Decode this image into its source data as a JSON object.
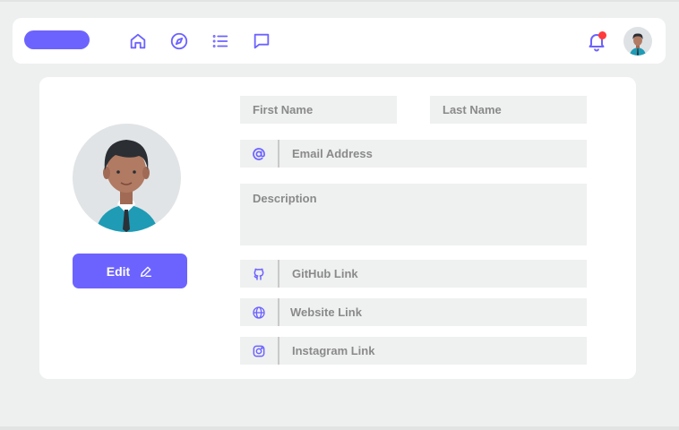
{
  "colors": {
    "accent": "#6c63ff",
    "notification": "#ff3b3b",
    "field_bg": "#eff0f0"
  },
  "nav": {
    "icons": [
      "home-icon",
      "compass-icon",
      "list-icon",
      "chat-icon"
    ],
    "notification_icon": "bell-icon",
    "has_notification": true
  },
  "profile": {
    "edit_label": "Edit",
    "edit_icon": "pencil-icon"
  },
  "form": {
    "first_name": {
      "placeholder": "First Name"
    },
    "last_name": {
      "placeholder": "Last Name"
    },
    "email": {
      "placeholder": "Email Address",
      "icon": "at-icon"
    },
    "description": {
      "placeholder": "Description"
    },
    "github": {
      "placeholder": "GitHub Link",
      "icon": "github-icon"
    },
    "website": {
      "placeholder": "Website Link",
      "icon": "globe-icon"
    },
    "instagram": {
      "placeholder": "Instagram Link",
      "icon": "instagram-icon"
    }
  }
}
